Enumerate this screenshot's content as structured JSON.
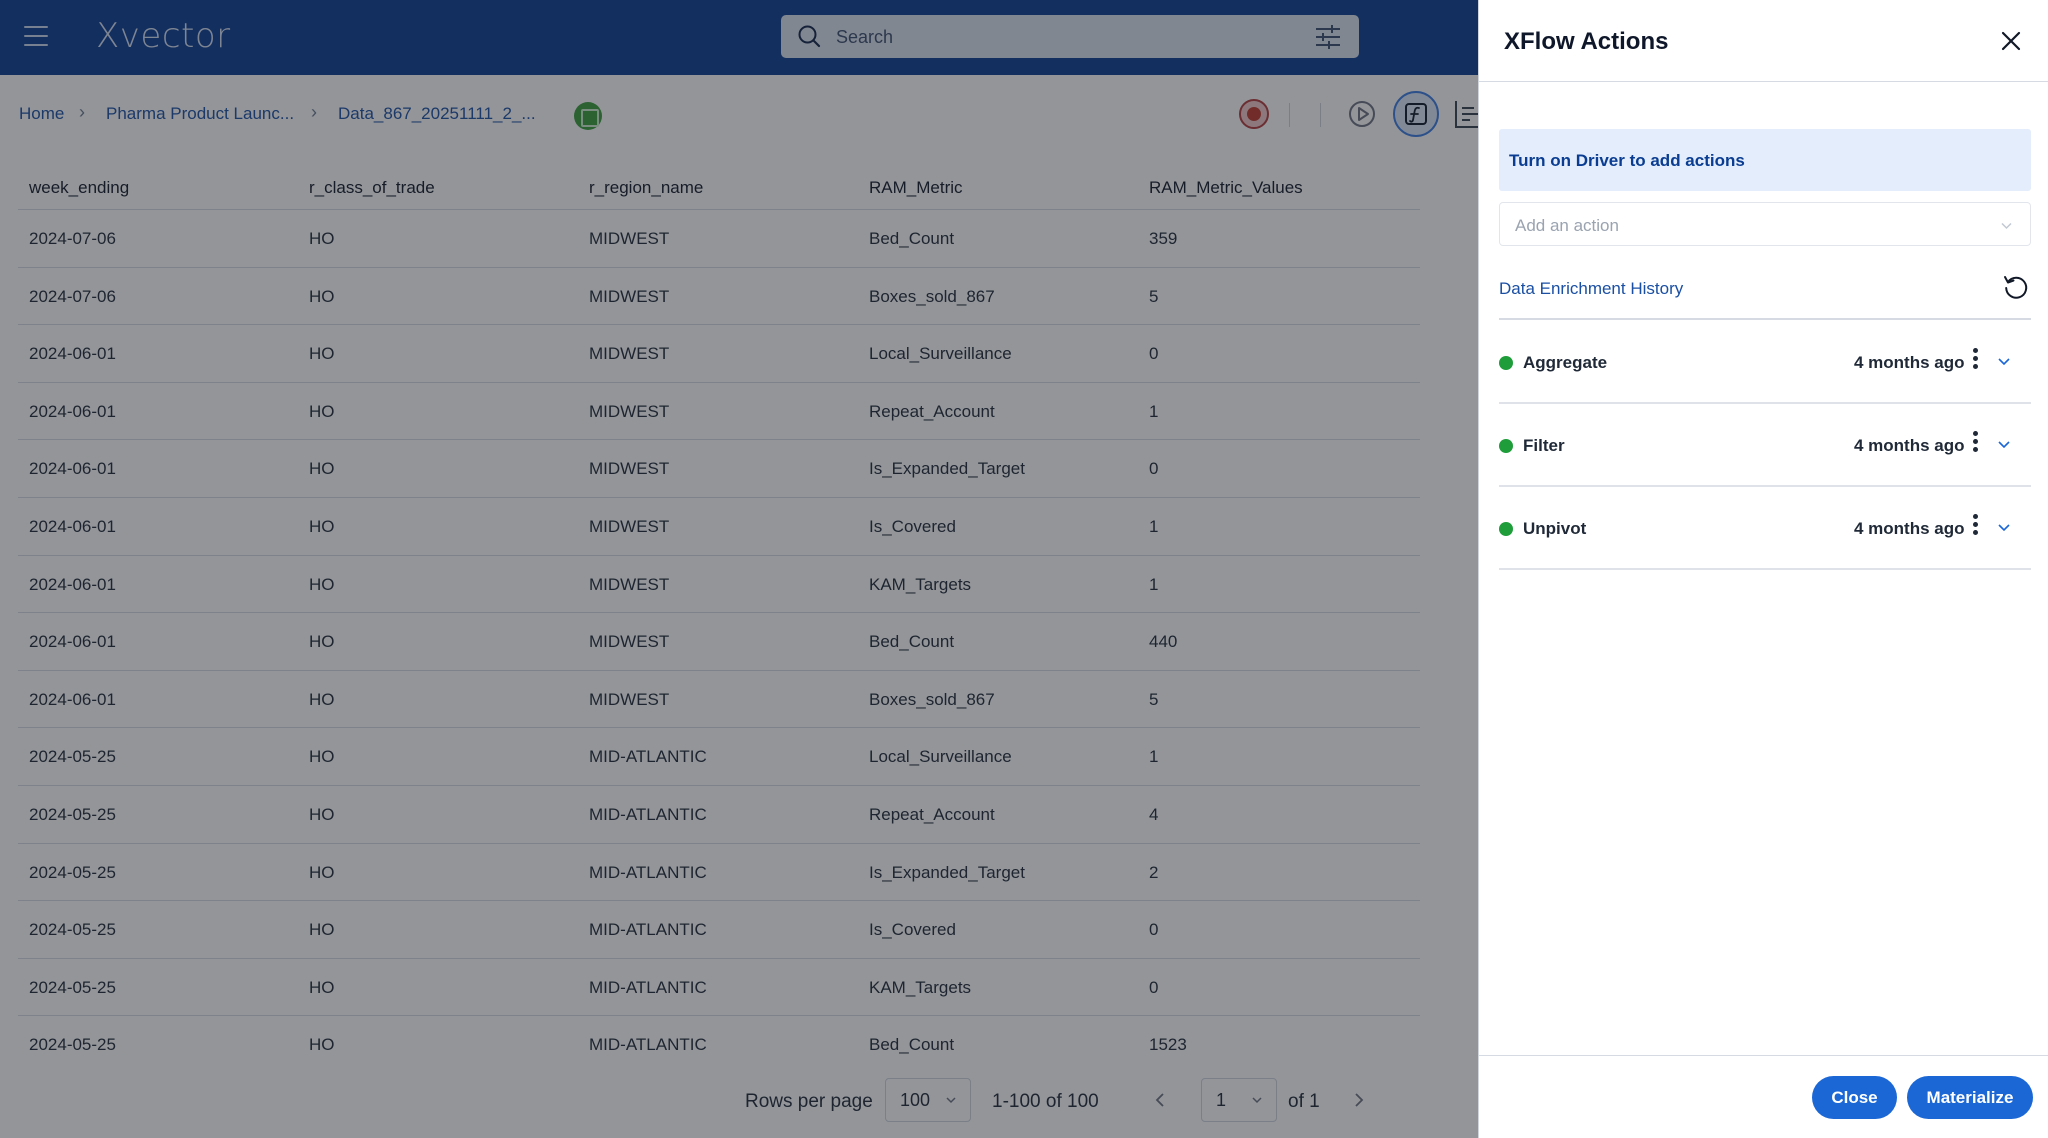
{
  "app": {
    "logo": "Xvector"
  },
  "search": {
    "placeholder": "Search"
  },
  "breadcrumb": {
    "home": "Home",
    "project": "Pharma Product Launc...",
    "dataset": "Data_867_20251111_2_..."
  },
  "table": {
    "columns": [
      "week_ending",
      "r_class_of_trade",
      "r_region_name",
      "RAM_Metric",
      "RAM_Metric_Values"
    ],
    "rows": [
      [
        "2024-07-06",
        "HO",
        "MIDWEST",
        "Bed_Count",
        "359"
      ],
      [
        "2024-07-06",
        "HO",
        "MIDWEST",
        "Boxes_sold_867",
        "5"
      ],
      [
        "2024-06-01",
        "HO",
        "MIDWEST",
        "Local_Surveillance",
        "0"
      ],
      [
        "2024-06-01",
        "HO",
        "MIDWEST",
        "Repeat_Account",
        "1"
      ],
      [
        "2024-06-01",
        "HO",
        "MIDWEST",
        "Is_Expanded_Target",
        "0"
      ],
      [
        "2024-06-01",
        "HO",
        "MIDWEST",
        "Is_Covered",
        "1"
      ],
      [
        "2024-06-01",
        "HO",
        "MIDWEST",
        "KAM_Targets",
        "1"
      ],
      [
        "2024-06-01",
        "HO",
        "MIDWEST",
        "Bed_Count",
        "440"
      ],
      [
        "2024-06-01",
        "HO",
        "MIDWEST",
        "Boxes_sold_867",
        "5"
      ],
      [
        "2024-05-25",
        "HO",
        "MID-ATLANTIC",
        "Local_Surveillance",
        "1"
      ],
      [
        "2024-05-25",
        "HO",
        "MID-ATLANTIC",
        "Repeat_Account",
        "4"
      ],
      [
        "2024-05-25",
        "HO",
        "MID-ATLANTIC",
        "Is_Expanded_Target",
        "2"
      ],
      [
        "2024-05-25",
        "HO",
        "MID-ATLANTIC",
        "Is_Covered",
        "0"
      ],
      [
        "2024-05-25",
        "HO",
        "MID-ATLANTIC",
        "KAM_Targets",
        "0"
      ],
      [
        "2024-05-25",
        "HO",
        "MID-ATLANTIC",
        "Bed_Count",
        "1523"
      ]
    ]
  },
  "pagination": {
    "rows_per_page_label": "Rows per page",
    "rows_per_page": "100",
    "range": "1-100 of 100",
    "page": "1",
    "of_pages": "of 1"
  },
  "drawer": {
    "title": "XFlow Actions",
    "driver_notice": "Turn on Driver to add actions",
    "add_action_placeholder": "Add an action",
    "history_title": "Data Enrichment History",
    "actions": [
      {
        "name": "Aggregate",
        "time": "4 months ago",
        "status_color": "#1f9d3a"
      },
      {
        "name": "Filter",
        "time": "4 months ago",
        "status_color": "#1f9d3a"
      },
      {
        "name": "Unpivot",
        "time": "4 months ago",
        "status_color": "#1f9d3a"
      }
    ],
    "close_label": "Close",
    "materialize_label": "Materialize"
  },
  "colors": {
    "topbar": "#0a3d91",
    "accent": "#1b67d6",
    "status_green": "#1f9d3a",
    "notice_bg": "#e3edfb"
  },
  "icons": {
    "menu": "hamburger-icon",
    "search": "search-icon",
    "filter": "filter-sliders-icon",
    "dataset": "dataset-grid-icon",
    "record": "record-icon",
    "run": "play-icon",
    "formula": "formula-icon",
    "chart": "chart-icon",
    "close": "close-icon",
    "history": "history-icon"
  }
}
